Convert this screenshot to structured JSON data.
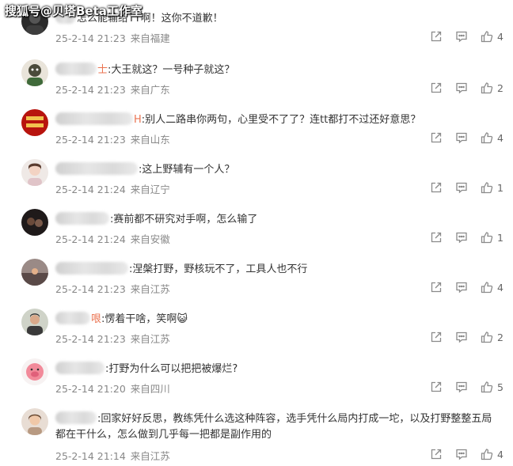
{
  "watermark": {
    "text": "搜狐号@贝塔Beta工作室"
  },
  "comments": [
    {
      "name_tail": "",
      "content": "怎么能输给TT啊！这你不道歉！",
      "date": "25-2-14 21:23",
      "location": "来自福建",
      "likes": "4",
      "avatar": "dark-avatar"
    },
    {
      "name_tail": "士",
      "content": ":大王就这？一号种子就这？",
      "date": "25-2-14 21:23",
      "location": "来自广东",
      "likes": "2",
      "avatar": "cartoon-avatar"
    },
    {
      "name_tail": "H",
      "content": ":别人二路串你两句，心里受不了了？连tt都打不过还好意思？",
      "date": "25-2-14 21:23",
      "location": "来自山东",
      "likes": "4",
      "avatar": "red-avatar"
    },
    {
      "name_tail": "",
      "content": ":这上野辅有一个人？",
      "date": "25-2-14 21:24",
      "location": "来自辽宁",
      "likes": "1",
      "avatar": "girl-avatar"
    },
    {
      "name_tail": "",
      "content": ":赛前都不研究对手啊，怎么输了",
      "date": "25-2-14 21:24",
      "location": "来自安徽",
      "likes": "1",
      "avatar": "night-avatar"
    },
    {
      "name_tail": "",
      "content": ":涅槃打野，野核玩不了，工具人也不行",
      "date": "25-2-14 21:23",
      "location": "来自江苏",
      "likes": "4",
      "avatar": "sunset-avatar"
    },
    {
      "name_tail": "哏",
      "content": ":愣着干啥，笑啊",
      "emoji": "😺",
      "date": "25-2-14 21:23",
      "location": "来自江苏",
      "likes": "2",
      "avatar": "man-avatar"
    },
    {
      "name_tail": "",
      "content": ":打野为什么可以把把被爆烂?",
      "date": "25-2-14 21:20",
      "location": "来自四川",
      "likes": "5",
      "avatar": "pig-avatar"
    },
    {
      "name_tail": "",
      "content": ":回家好好反思，教练凭什么选这种阵容，选手凭什么局内打成一坨，以及打野整整五局都在干什么，怎么做到几乎每一把都是副作用的",
      "date": "25-2-14 21:14",
      "location": "来自江苏",
      "likes": "4",
      "avatar": "woman-avatar"
    }
  ],
  "colors": {
    "name_accent": "#eb7350",
    "meta_text": "#888888",
    "icon_stroke": "#8a8a8a"
  }
}
